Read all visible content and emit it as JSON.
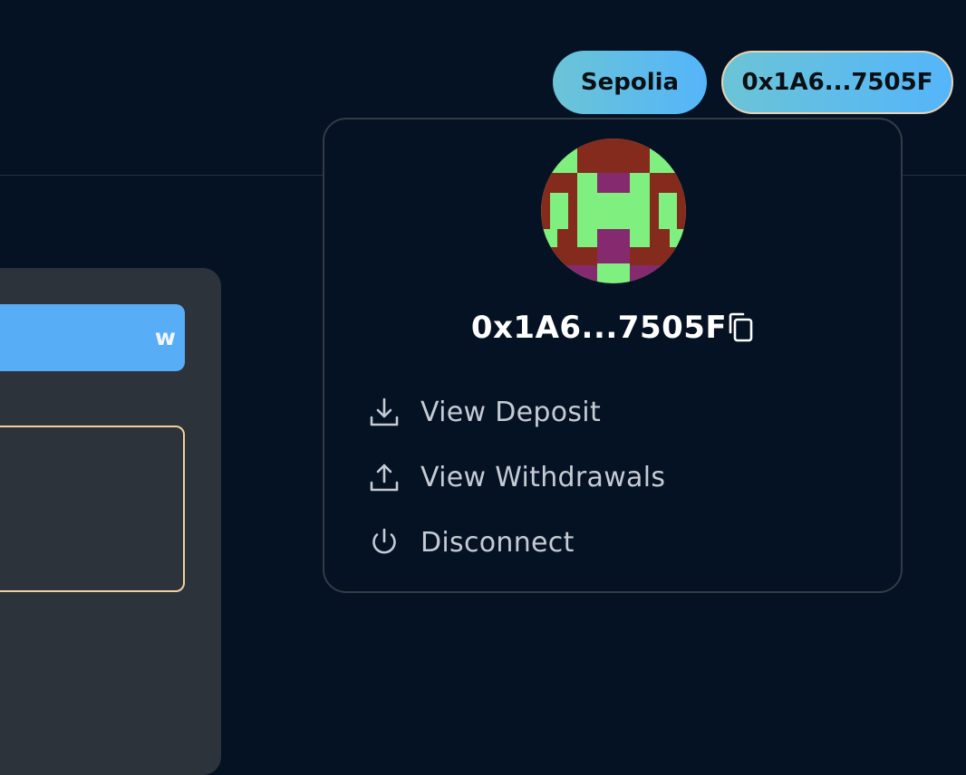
{
  "header": {
    "network_label": "Sepolia",
    "account_label": "0x1A6...7505F"
  },
  "left_panel": {
    "button_label_fragment": "w"
  },
  "dropdown": {
    "address": "0x1A6...7505F",
    "menu_items": [
      {
        "label": "View Deposit",
        "icon": "download-icon"
      },
      {
        "label": "View Withdrawals",
        "icon": "upload-icon"
      },
      {
        "label": "Disconnect",
        "icon": "power-icon"
      }
    ]
  },
  "colors": {
    "background": "#041224",
    "pill_gradient_start": "#6bc4d6",
    "pill_gradient_end": "#54b5fa",
    "panel": "#2d333b",
    "panel_button": "#58adf7",
    "panel_box_border": "#f3cf9e",
    "avatar_green": "#7ff07f",
    "avatar_red": "#852b1e",
    "avatar_purple": "#852a6e"
  }
}
